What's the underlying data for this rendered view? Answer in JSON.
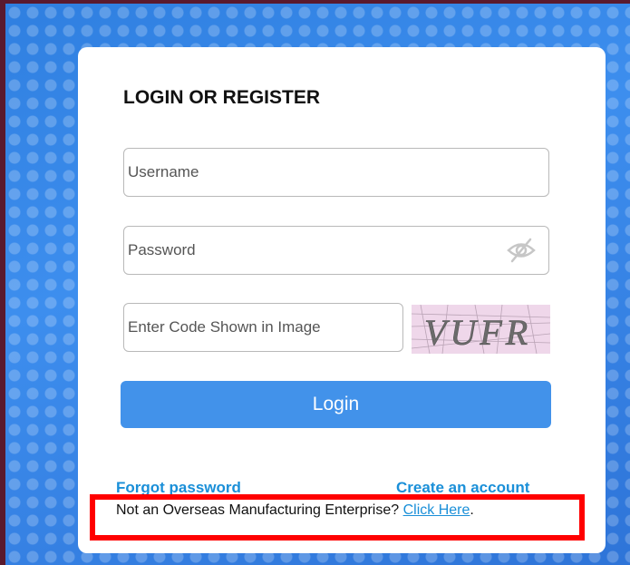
{
  "login_form": {
    "title": "LOGIN OR REGISTER",
    "username_placeholder": "Username",
    "password_placeholder": "Password",
    "code_placeholder": "Enter Code Shown in Image",
    "captcha_text": "VUFR",
    "login_label": "Login",
    "forgot_label": "Forgot password",
    "create_label": "Create an account",
    "note_text": "Not an Overseas Manufacturing Enterprise? ",
    "note_link": "Click Here",
    "note_end": "."
  },
  "icons": {
    "password_toggle": "eye-slash-icon"
  },
  "colors": {
    "accent": "#4292ea",
    "link": "#1a8fd8",
    "highlight": "#ff0000",
    "background": "#3f8ee6"
  }
}
